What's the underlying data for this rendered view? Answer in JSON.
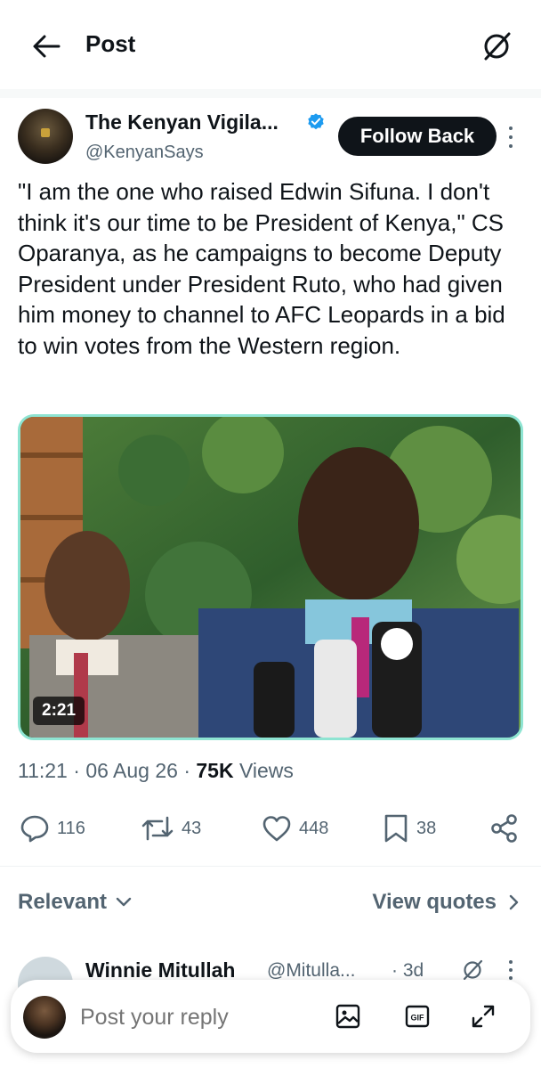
{
  "header": {
    "title": "Post",
    "back_icon": "arrow-left-icon",
    "grok_icon": "grok-slash-icon"
  },
  "post": {
    "author": {
      "display_name": "The Kenyan Vigila...",
      "handle": "@KenyanSays",
      "verified": true,
      "verified_color": "#1d9bf0"
    },
    "follow_label": "Follow Back",
    "text": "\"I am the one who raised Edwin Sifuna. I don't think it's our time to be President of Kenya,\"  CS Oparanya, as he campaigns to become Deputy President under President Ruto, who had  given him money  to channel to AFC Leopards in a bid to win votes from the Western region.",
    "video": {
      "duration": "2:21"
    },
    "meta": {
      "time": "11:21",
      "separator": "·",
      "date": "06 Aug 26",
      "views_count": "75K",
      "views_label": "Views"
    },
    "actions": {
      "replies": "116",
      "reposts": "43",
      "likes": "448",
      "bookmarks": "38"
    }
  },
  "replies": {
    "sort_label": "Relevant",
    "view_quotes_label": "View quotes",
    "first_reply": {
      "name": "Winnie Mitullah",
      "handle": "@Mitulla...",
      "time": "· 3d"
    }
  },
  "compose": {
    "placeholder": "Post your reply"
  },
  "colors": {
    "text_primary": "#0f1419",
    "text_secondary": "#536471",
    "follow_button_bg": "#0f1419",
    "verified": "#1d9bf0"
  }
}
